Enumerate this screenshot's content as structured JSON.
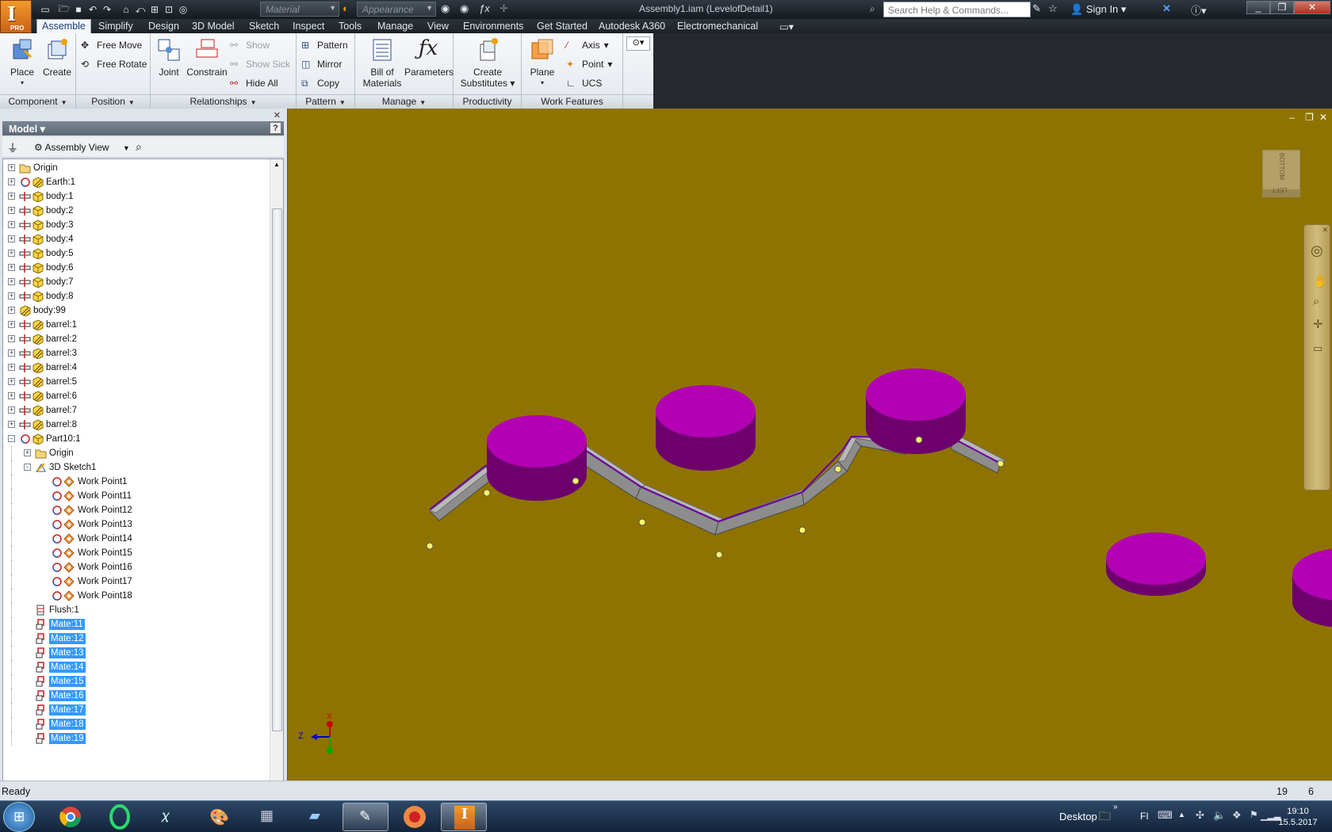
{
  "titlebar": {
    "document_title": "Assembly1.iam (LevelofDetail1)",
    "material_combo": "Material",
    "appearance_combo": "Appearance",
    "search_placeholder": "Search Help & Commands...",
    "signin": "Sign In",
    "app_badge": "PRO"
  },
  "tabs": [
    "Assemble",
    "Simplify",
    "Design",
    "3D Model",
    "Sketch",
    "Inspect",
    "Tools",
    "Manage",
    "View",
    "Environments",
    "Get Started",
    "Autodesk A360",
    "Electromechanical"
  ],
  "ribbon": {
    "component": {
      "title": "Component",
      "place": "Place",
      "create": "Create"
    },
    "position": {
      "title": "Position",
      "free_move": "Free Move",
      "free_rotate": "Free Rotate"
    },
    "relationships": {
      "title": "Relationships",
      "joint": "Joint",
      "constrain": "Constrain",
      "show": "Show",
      "show_sick": "Show Sick",
      "hide_all": "Hide All"
    },
    "pattern": {
      "title": "Pattern",
      "pattern": "Pattern",
      "mirror": "Mirror",
      "copy": "Copy"
    },
    "manage": {
      "title": "Manage",
      "bill_line1": "Bill of",
      "bill_line2": "Materials",
      "parameters": "Parameters"
    },
    "productivity": {
      "title": "Productivity",
      "subs_line1": "Create",
      "subs_line2": "Substitutes"
    },
    "work_features": {
      "title": "Work Features",
      "plane": "Plane",
      "axis": "Axis",
      "point": "Point",
      "ucs": "UCS"
    }
  },
  "browser": {
    "header": "Model",
    "view": "Assembly View",
    "help": "?"
  },
  "tree": [
    {
      "label": "Origin",
      "level": 0,
      "icon": "folder-icon",
      "exp": "+"
    },
    {
      "label": "Earth:1",
      "level": 0,
      "icon": "part-grounded-icon",
      "pre": "rotate-constraint-icon",
      "exp": "+"
    },
    {
      "label": "body:1",
      "level": 0,
      "icon": "part-icon",
      "pre": "joint-icon",
      "exp": "+"
    },
    {
      "label": "body:2",
      "level": 0,
      "icon": "part-icon",
      "pre": "joint-icon",
      "exp": "+"
    },
    {
      "label": "body:3",
      "level": 0,
      "icon": "part-icon",
      "pre": "joint-icon",
      "exp": "+"
    },
    {
      "label": "body:4",
      "level": 0,
      "icon": "part-icon",
      "pre": "joint-icon",
      "exp": "+"
    },
    {
      "label": "body:5",
      "level": 0,
      "icon": "part-icon",
      "pre": "joint-icon",
      "exp": "+"
    },
    {
      "label": "body:6",
      "level": 0,
      "icon": "part-icon",
      "pre": "joint-icon",
      "exp": "+"
    },
    {
      "label": "body:7",
      "level": 0,
      "icon": "part-icon",
      "pre": "joint-icon",
      "exp": "+"
    },
    {
      "label": "body:8",
      "level": 0,
      "icon": "part-icon",
      "pre": "joint-icon",
      "exp": "+"
    },
    {
      "label": "body:99",
      "level": 0,
      "icon": "part-grounded-icon",
      "exp": "+"
    },
    {
      "label": "barrel:1",
      "level": 0,
      "icon": "part-grounded-icon",
      "pre": "joint-icon",
      "exp": "+"
    },
    {
      "label": "barrel:2",
      "level": 0,
      "icon": "part-grounded-icon",
      "pre": "joint-icon",
      "exp": "+"
    },
    {
      "label": "barrel:3",
      "level": 0,
      "icon": "part-grounded-icon",
      "pre": "joint-icon",
      "exp": "+"
    },
    {
      "label": "barrel:4",
      "level": 0,
      "icon": "part-grounded-icon",
      "pre": "joint-icon",
      "exp": "+"
    },
    {
      "label": "barrel:5",
      "level": 0,
      "icon": "part-grounded-icon",
      "pre": "joint-icon",
      "exp": "+"
    },
    {
      "label": "barrel:6",
      "level": 0,
      "icon": "part-grounded-icon",
      "pre": "joint-icon",
      "exp": "+"
    },
    {
      "label": "barrel:7",
      "level": 0,
      "icon": "part-grounded-icon",
      "pre": "joint-icon",
      "exp": "+"
    },
    {
      "label": "barrel:8",
      "level": 0,
      "icon": "part-grounded-icon",
      "pre": "joint-icon",
      "exp": "+"
    },
    {
      "label": "Part10:1",
      "level": 0,
      "icon": "part-icon",
      "pre": "rotate-constraint-icon",
      "exp": "-"
    },
    {
      "label": "Origin",
      "level": 1,
      "icon": "folder-icon",
      "exp": "+"
    },
    {
      "label": "3D Sketch1",
      "level": 1,
      "icon": "sketch3d-icon",
      "exp": "-"
    },
    {
      "label": "Work Point1",
      "level": 2,
      "icon": "workpoint-icon",
      "pre": "rotate-constraint-icon"
    },
    {
      "label": "Work Point11",
      "level": 2,
      "icon": "workpoint-icon",
      "pre": "rotate-constraint-icon"
    },
    {
      "label": "Work Point12",
      "level": 2,
      "icon": "workpoint-icon",
      "pre": "rotate-constraint-icon"
    },
    {
      "label": "Work Point13",
      "level": 2,
      "icon": "workpoint-icon",
      "pre": "rotate-constraint-icon"
    },
    {
      "label": "Work Point14",
      "level": 2,
      "icon": "workpoint-icon",
      "pre": "rotate-constraint-icon"
    },
    {
      "label": "Work Point15",
      "level": 2,
      "icon": "workpoint-icon",
      "pre": "rotate-constraint-icon"
    },
    {
      "label": "Work Point16",
      "level": 2,
      "icon": "workpoint-icon",
      "pre": "rotate-constraint-icon"
    },
    {
      "label": "Work Point17",
      "level": 2,
      "icon": "workpoint-icon",
      "pre": "rotate-constraint-icon"
    },
    {
      "label": "Work Point18",
      "level": 2,
      "icon": "workpoint-icon",
      "pre": "rotate-constraint-icon"
    },
    {
      "label": "Flush:1",
      "level": 1,
      "icon": "flush-icon"
    },
    {
      "label": "Mate:11",
      "level": 1,
      "icon": "mate-icon",
      "selected": true
    },
    {
      "label": "Mate:12",
      "level": 1,
      "icon": "mate-icon",
      "selected": true
    },
    {
      "label": "Mate:13",
      "level": 1,
      "icon": "mate-icon",
      "selected": true
    },
    {
      "label": "Mate:14",
      "level": 1,
      "icon": "mate-icon",
      "selected": true
    },
    {
      "label": "Mate:15",
      "level": 1,
      "icon": "mate-icon",
      "selected": true
    },
    {
      "label": "Mate:16",
      "level": 1,
      "icon": "mate-icon",
      "selected": true
    },
    {
      "label": "Mate:17",
      "level": 1,
      "icon": "mate-icon",
      "selected": true
    },
    {
      "label": "Mate:18",
      "level": 1,
      "icon": "mate-icon",
      "selected": true
    },
    {
      "label": "Mate:19",
      "level": 1,
      "icon": "mate-icon",
      "selected": true
    }
  ],
  "viewport": {
    "background": "#8f7300",
    "disk_color": "#b400b4",
    "disk_side": "#6e006e",
    "viewcube_top": "BOTTOM",
    "viewcube_side": "LEFT",
    "triad": {
      "x": "X",
      "z": "Z"
    }
  },
  "status": {
    "text": "Ready",
    "count1": "19",
    "count2": "6"
  },
  "taskbar": {
    "desktop": "Desktop",
    "lang": "FI",
    "time": "19:10",
    "date": "15.5.2017"
  }
}
